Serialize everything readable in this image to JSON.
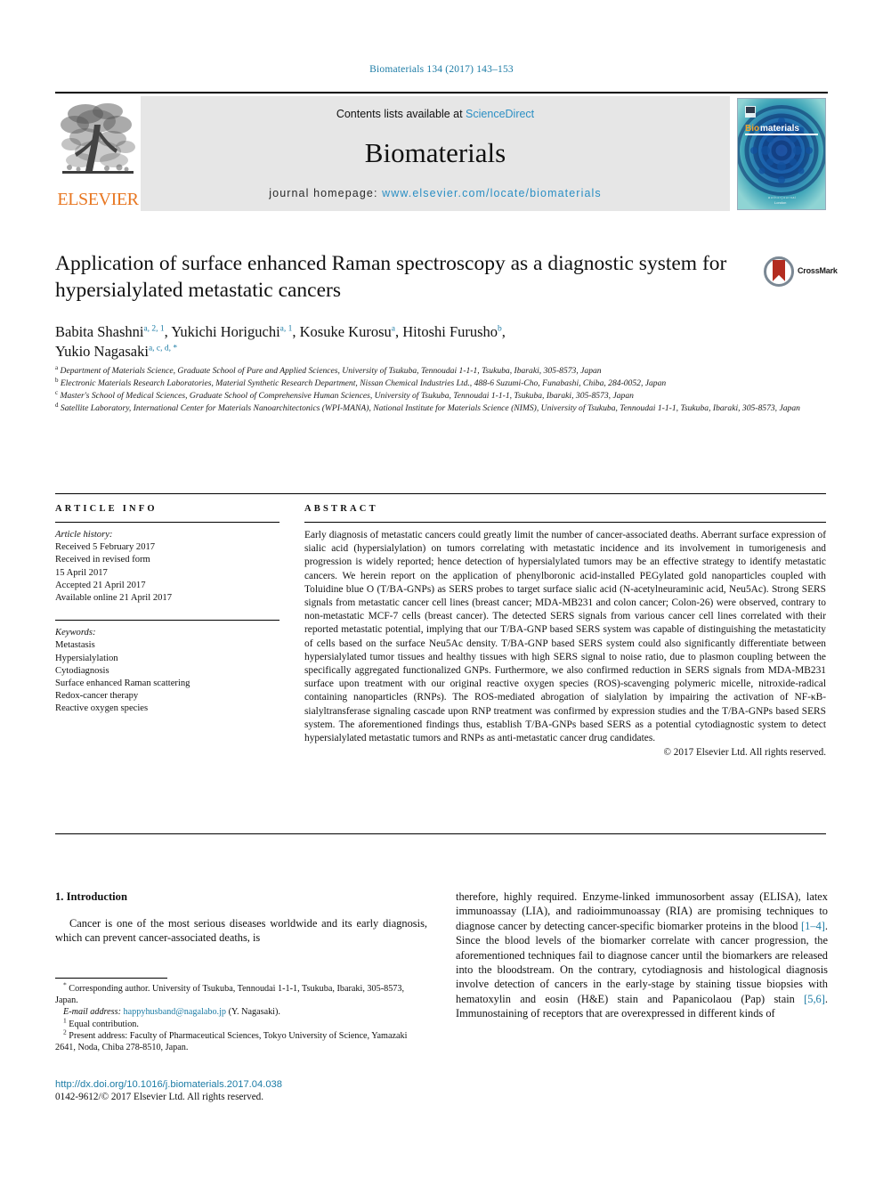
{
  "running_head": "Biomaterials 134 (2017) 143–153",
  "masthead": {
    "publisher_name": "ELSEVIER",
    "contents_prefix": "Contents lists available at ",
    "contents_link": "ScienceDirect",
    "journal_title": "Biomaterials",
    "homepage_prefix": "journal homepage: ",
    "homepage_url": "www.elsevier.com/locate/biomaterials",
    "cover": {
      "brand_first": "Bio",
      "brand_second": "materials",
      "brand_first_color": "#f0a32a",
      "brand_second_color": "#ffffff",
      "footer_line1": "a u t h o r   j o u r n a l",
      "footer_line2": "London"
    }
  },
  "article": {
    "title": "Application of surface enhanced Raman spectroscopy as a diagnostic system for hypersialylated metastatic cancers",
    "crossmark_label": "CrossMark",
    "authors_line1_pre": "Babita Shashni ",
    "authors": [
      {
        "name": "Babita Shashni",
        "sup": "a, 2, 1"
      },
      {
        "name": "Yukichi Horiguchi",
        "sup": "a, 1"
      },
      {
        "name": "Kosuke Kurosu",
        "sup": "a"
      },
      {
        "name": "Hitoshi Furusho",
        "sup": "b"
      },
      {
        "name": "Yukio Nagasaki",
        "sup": "a, c, d, *"
      }
    ],
    "affiliations": [
      {
        "mark": "a",
        "text": "Department of Materials Science, Graduate School of Pure and Applied Sciences, University of Tsukuba, Tennoudai 1-1-1, Tsukuba, Ibaraki, 305-8573, Japan"
      },
      {
        "mark": "b",
        "text": "Electronic Materials Research Laboratories, Material Synthetic Research Department, Nissan Chemical Industries Ltd., 488-6 Suzumi-Cho, Funabashi, Chiba, 284-0052, Japan"
      },
      {
        "mark": "c",
        "text": "Master's School of Medical Sciences, Graduate School of Comprehensive Human Sciences, University of Tsukuba, Tennoudai 1-1-1, Tsukuba, Ibaraki, 305-8573, Japan"
      },
      {
        "mark": "d",
        "text": "Satellite Laboratory, International Center for Materials Nanoarchitectonics (WPI-MANA), National Institute for Materials Science (NIMS), University of Tsukuba, Tennoudai 1-1-1, Tsukuba, Ibaraki, 305-8573, Japan"
      }
    ]
  },
  "article_info": {
    "heading": "ARTICLE INFO",
    "history_label": "Article history:",
    "history": [
      "Received 5 February 2017",
      "Received in revised form",
      "15 April 2017",
      "Accepted 21 April 2017",
      "Available online 21 April 2017"
    ],
    "keywords_label": "Keywords:",
    "keywords": [
      "Metastasis",
      "Hypersialylation",
      "Cytodiagnosis",
      "Surface enhanced Raman scattering",
      "Redox-cancer therapy",
      "Reactive oxygen species"
    ]
  },
  "abstract": {
    "heading": "ABSTRACT",
    "text": "Early diagnosis of metastatic cancers could greatly limit the number of cancer-associated deaths. Aberrant surface expression of sialic acid (hypersialylation) on tumors correlating with metastatic incidence and its involvement in tumorigenesis and progression is widely reported; hence detection of hypersialylated tumors may be an effective strategy to identify metastatic cancers. We herein report on the application of phenylboronic acid-installed PEGylated gold nanoparticles coupled with Toluidine blue O (T/BA-GNPs) as SERS probes to target surface sialic acid (N-acetylneuraminic acid, Neu5Ac). Strong SERS signals from metastatic cancer cell lines (breast cancer; MDA-MB231 and colon cancer; Colon-26) were observed, contrary to non-metastatic MCF-7 cells (breast cancer). The detected SERS signals from various cancer cell lines correlated with their reported metastatic potential, implying that our T/BA-GNP based SERS system was capable of distinguishing the metastaticity of cells based on the surface Neu5Ac density. T/BA-GNP based SERS system could also significantly differentiate between hypersialylated tumor tissues and healthy tissues with high SERS signal to noise ratio, due to plasmon coupling between the specifically aggregated functionalized GNPs. Furthermore, we also confirmed reduction in SERS signals from MDA-MB231 surface upon treatment with our original reactive oxygen species (ROS)-scavenging polymeric micelle, nitroxide-radical containing nanoparticles (RNPs). The ROS-mediated abrogation of sialylation by impairing the activation of NF-κB-sialyltransferase signaling cascade upon RNP treatment was confirmed by expression studies and the T/BA-GNPs based SERS system. The aforementioned findings thus, establish T/BA-GNPs based SERS as a potential cytodiagnostic system to detect hypersialylated metastatic tumors and RNPs as anti-metastatic cancer drug candidates.",
    "copyright": "© 2017 Elsevier Ltd. All rights reserved."
  },
  "body": {
    "section_number_title": "1.  Introduction",
    "left_paragraph": "Cancer is one of the most serious diseases worldwide and its early diagnosis, which can prevent cancer-associated deaths, is",
    "right_paragraph_part1": "therefore, highly required. Enzyme-linked immunosorbent assay (ELISA), latex immunoassay (LIA), and radioimmunoassay (RIA) are promising techniques to diagnose cancer by detecting cancer-specific biomarker proteins in the blood ",
    "right_ref1": "[1–4]",
    "right_paragraph_part2": ". Since the blood levels of the biomarker correlate with cancer progression, the aforementioned techniques fail to diagnose cancer until the biomarkers are released into the bloodstream. On the contrary, cytodiagnosis and histological diagnosis involve detection of cancers in the early-stage by staining tissue biopsies with hematoxylin and eosin (H&E) stain and Papanicolaou (Pap) stain ",
    "right_ref2": "[5,6]",
    "right_paragraph_part3": ". Immunostaining of receptors that are overexpressed in different kinds of"
  },
  "footnotes": {
    "corresponding_mark": "*",
    "corresponding": "Corresponding author. University of Tsukuba, Tennoudai 1-1-1, Tsukuba, Ibaraki, 305-8573, Japan.",
    "email_label": "E-mail address:",
    "email": "happyhusband@nagalabo.jp",
    "email_owner": "(Y. Nagasaki).",
    "note1_mark": "1",
    "note1": "Equal contribution.",
    "note2_mark": "2",
    "note2": "Present address: Faculty of Pharmaceutical Sciences, Tokyo University of Science, Yamazaki 2641, Noda, Chiba 278-8510, Japan."
  },
  "footer": {
    "doi": "http://dx.doi.org/10.1016/j.biomaterials.2017.04.038",
    "issn_line": "0142-9612/© 2017 Elsevier Ltd. All rights reserved."
  }
}
